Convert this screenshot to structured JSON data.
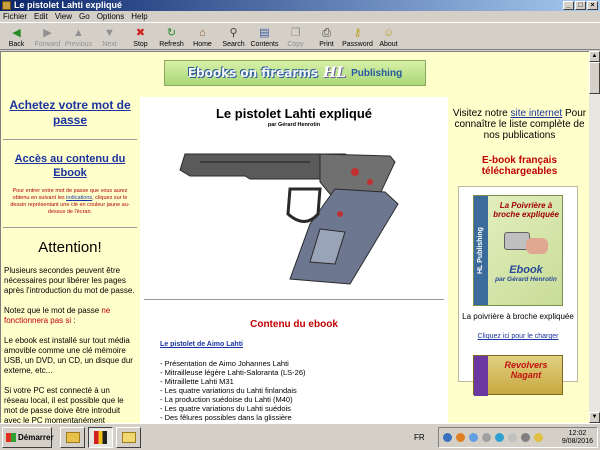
{
  "window": {
    "title": "Le pistolet Lahti expliqué",
    "controls": [
      "_",
      "□",
      "×"
    ]
  },
  "menu": [
    "Fichier",
    "Edit",
    "View",
    "Go",
    "Options",
    "Help"
  ],
  "toolbar": [
    {
      "label": "Back",
      "icon": "back-arrow-icon",
      "glyph": "◀",
      "color": "#2a8a2a",
      "disabled": false
    },
    {
      "label": "Forward",
      "icon": "forward-arrow-icon",
      "glyph": "▶",
      "color": "#909090",
      "disabled": true
    },
    {
      "label": "Previous",
      "icon": "up-arrow-icon",
      "glyph": "▲",
      "color": "#909090",
      "disabled": true
    },
    {
      "label": "Next",
      "icon": "down-arrow-icon",
      "glyph": "▼",
      "color": "#909090",
      "disabled": true
    },
    {
      "label": "Stop",
      "icon": "stop-icon",
      "glyph": "✖",
      "color": "#d02020",
      "disabled": false
    },
    {
      "label": "Refresh",
      "icon": "refresh-icon",
      "glyph": "↻",
      "color": "#2a8a2a",
      "disabled": false
    },
    {
      "label": "Home",
      "icon": "home-icon",
      "glyph": "⌂",
      "color": "#8a5a20",
      "disabled": false
    },
    {
      "label": "Search",
      "icon": "search-icon",
      "glyph": "⚲",
      "color": "#404040",
      "disabled": false
    },
    {
      "label": "Contents",
      "icon": "contents-icon",
      "glyph": "▤",
      "color": "#3a5aa0",
      "disabled": false
    },
    {
      "label": "Copy",
      "icon": "copy-icon",
      "glyph": "❐",
      "color": "#909090",
      "disabled": true
    },
    {
      "label": "Print",
      "icon": "print-icon",
      "glyph": "⎙",
      "color": "#404040",
      "disabled": false
    },
    {
      "label": "Password",
      "icon": "key-icon",
      "glyph": "⚷",
      "color": "#c0a020",
      "disabled": false
    },
    {
      "label": "About",
      "icon": "about-icon",
      "glyph": "☺",
      "color": "#c0a020",
      "disabled": false
    }
  ],
  "banner": {
    "part1": "Ebooks on firearms",
    "part2": "HL",
    "part3": "Publishing"
  },
  "left": {
    "buy_link": "Achetez votre mot de passe",
    "access_link": "Accès au contenu du Ebook",
    "note_before": "Pour entrer votre mot de passe que vous aurez obtenu en suivant les ",
    "note_link": "indications",
    "note_after": ", cliquez sur le dessin représentant une clé en couleur jaune au-dessus de l'écran.",
    "attention": "Attention!",
    "p1": "Plusieurs secondes peuvent être nécessaires pour libérer les pages après l'introduction du mot de passe.",
    "p2_before": "Notez que le mot de passe ",
    "p2_red": "ne fonctionnera pas si",
    "p2_after": " :",
    "p3": "Le ebook est installé sur tout média amovible comme une clé mémoire USB, un DVD, un CD, un disque dur externe, etc...",
    "p4": "Si votre PC est connecté à un réseau local, il est possible que le mot de passe doive être introduit avec le PC momentanément déconnecté..."
  },
  "center": {
    "title": "Le pistolet Lahti expliqué",
    "author": "par Gérard Henrotin",
    "contents_title": "Contenu du ebook",
    "contents_link": "Le pistolet de Aimo Lahti",
    "items": [
      "- Présentation de Aimo Johannes Lahti",
      "- Mitrailleuse légère Lahti-Saloranta (LS-26)",
      "- Mitraillette Lahti M31",
      "- Les quatre variations du Lahti finlandais",
      "- La production suédoise du Lahti (M40)",
      "- Les quatre variations du Lahti suédois",
      "- Des fêlures possibles dans la glissière"
    ]
  },
  "right": {
    "visit_before": "Visitez notre ",
    "visit_link": "site internet",
    "visit_after": " Pour connaître le liste complète de nos publications",
    "ebooks": "E-book français téléchargeables",
    "book1": {
      "spine": "HL Publishing",
      "title": "La Poivrière à broche expliquée",
      "ebook": "Ebook",
      "author": "par Gérard Henrotin"
    },
    "caption": "La poivrière à broche expliquée",
    "download_link": "Cliquez ici pour le charger",
    "book2": {
      "title": "Revolvers Nagant"
    }
  },
  "taskbar": {
    "start": "Démarrer",
    "lang": "FR",
    "time": "12:02",
    "date": "9/08/2016"
  }
}
